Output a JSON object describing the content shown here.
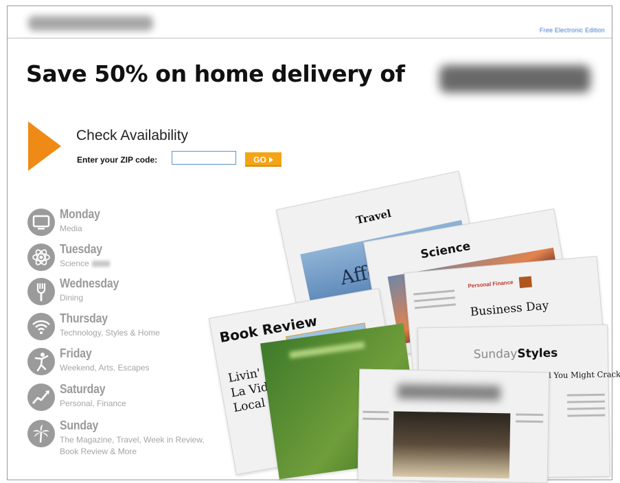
{
  "header": {
    "top_link": "Free Electronic Edition"
  },
  "main": {
    "headline": "Save 50% on home delivery of",
    "check_title": "Check Availability",
    "zip_label": "Enter your ZIP code:",
    "zip_value": "",
    "go_label": "GO"
  },
  "days": [
    {
      "name": "Monday",
      "sections": "Media",
      "icon": "tv-icon"
    },
    {
      "name": "Tuesday",
      "sections": "Science",
      "icon": "atom-icon"
    },
    {
      "name": "Wednesday",
      "sections": "Dining",
      "icon": "fork-icon"
    },
    {
      "name": "Thursday",
      "sections": "Technology, Styles & Home",
      "icon": "wifi-icon"
    },
    {
      "name": "Friday",
      "sections": "Weekend, Arts, Escapes",
      "icon": "dancer-icon"
    },
    {
      "name": "Saturday",
      "sections": "Personal, Finance",
      "icon": "chart-icon"
    },
    {
      "name": "Sunday",
      "sections": "The Magazine, Travel, Week in Review, Book Review & More",
      "icon": "palm-tree-icon"
    }
  ],
  "papers": {
    "travel": "Travel",
    "travel_headline": "Affo",
    "science": "Science",
    "business": "Business Day",
    "book_review": "Book Review",
    "book_lines": "Livin' La Vid Local",
    "sunday_styles_sunday": "Sunday",
    "sunday_styles": "Styles",
    "styles_headline": "a Diamond Under Stress, and You Might Crack",
    "finance": "Personal Finance"
  },
  "colors": {
    "accent_orange": "#f08a16",
    "go_button": "#f4a416",
    "day_gray": "#9a9a9a"
  }
}
